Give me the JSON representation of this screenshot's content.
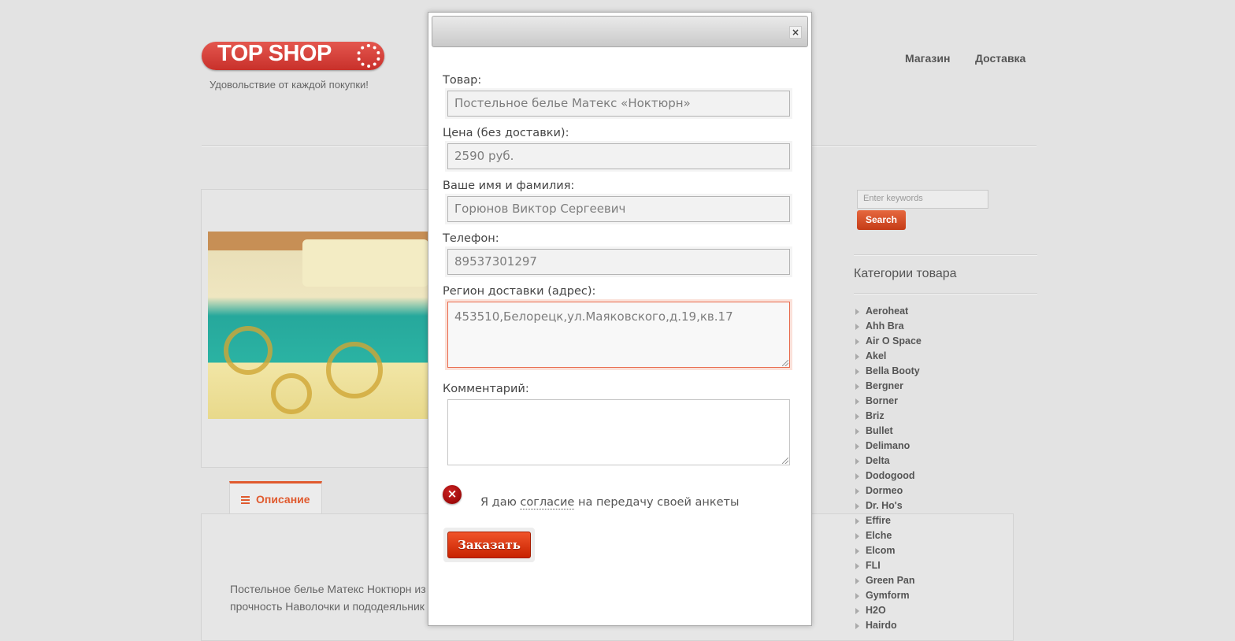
{
  "header": {
    "logo_text": "TOP SHOP",
    "tagline": "Удовольствие от каждой покупки!",
    "nav": [
      "Магазин",
      "Доставка"
    ]
  },
  "product": {
    "tab_label": "Описание",
    "description": "Постельное белье Матекс Ноктюрн из ... обладает рядом полезных качеств: эк... сминаемость прочность Наволочки и пододеяльник простроганы изнутри с одной стороны косым"
  },
  "sidebar": {
    "search_placeholder": "Enter keywords",
    "search_button": "Search",
    "categories_title": "Категории товара",
    "categories": [
      "Aeroheat",
      "Ahh Bra",
      "Air O Space",
      "Akel",
      "Bella Booty",
      "Bergner",
      "Borner",
      "Briz",
      "Bullet",
      "Delimano",
      "Delta",
      "Dodogood",
      "Dormeo",
      "Dr. Ho's",
      "Effire",
      "Elche",
      "Elcom",
      "FLI",
      "Green Pan",
      "Gymform",
      "H2O",
      "Hairdo"
    ]
  },
  "modal": {
    "close_glyph": "×",
    "fields": {
      "product": {
        "label": "Товар:",
        "value": "Постельное белье Матекс «Ноктюрн»"
      },
      "price": {
        "label": "Цена (без доставки):",
        "value": "2590 руб."
      },
      "name": {
        "label": "Ваше имя и фамилия:",
        "value": "Горюнов Виктор Сергеевич"
      },
      "phone": {
        "label": "Телефон:",
        "value": "89537301297"
      },
      "address": {
        "label": "Регион доставки (адрес):",
        "value": "453510,Белорецк,ул.Маяковского,д.19,кв.17"
      },
      "comment": {
        "label": "Комментарий:",
        "value": ""
      }
    },
    "consent": {
      "error_glyph": "×",
      "prefix": "Я даю ",
      "link": "согласие",
      "suffix": " на передачу своей анкеты"
    },
    "submit_label": "Заказать"
  },
  "colors": {
    "accent": "#e05a2e",
    "error": "#a00000",
    "focus_border": "#e86a4c"
  }
}
